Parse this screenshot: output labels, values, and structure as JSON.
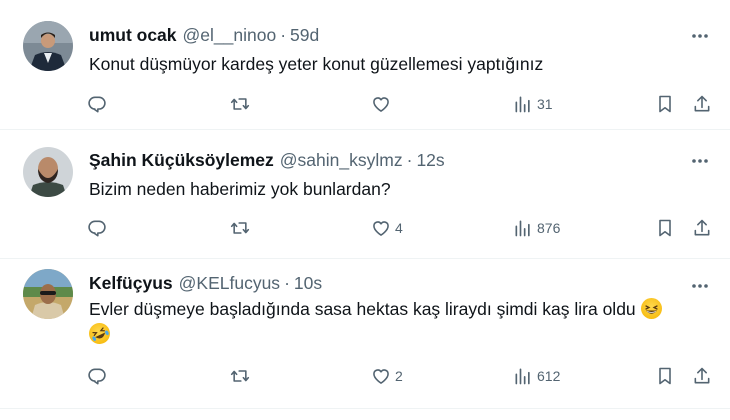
{
  "tweets": [
    {
      "name": "umut ocak",
      "handle": "@el__ninoo",
      "separator": "·",
      "time": "59d",
      "text": "Konut düşmüyor kardeş yeter konut güzellemesi yaptığınız",
      "replies": "",
      "retweets": "",
      "likes": "",
      "views": "31"
    },
    {
      "name": "Şahin Küçüksöylemez",
      "handle": "@sahin_ksylmz",
      "separator": "·",
      "time": "12s",
      "text": "Bizim neden haberimiz yok bunlardan?",
      "replies": "",
      "retweets": "",
      "likes": "4",
      "views": "876"
    },
    {
      "name": "Kelfüçyus",
      "handle": "@KELfucyus",
      "separator": "·",
      "time": "10s",
      "text": "Evler düşmeye başladığında sasa hektas kaş liraydı şimdi kaş lira oldu",
      "emojis": [
        "grinning-squinting-face",
        "rolling-on-floor-laughing"
      ],
      "replies": "",
      "retweets": "",
      "likes": "2",
      "views": "612"
    }
  ],
  "icons": {
    "reply": "reply-icon",
    "retweet": "retweet-icon",
    "like": "heart-icon",
    "views": "views-icon",
    "bookmark": "bookmark-icon",
    "share": "share-icon",
    "more": "more-icon"
  },
  "colors": {
    "text": "#0f1419",
    "secondary": "#536471",
    "divider": "#eff3f4"
  }
}
